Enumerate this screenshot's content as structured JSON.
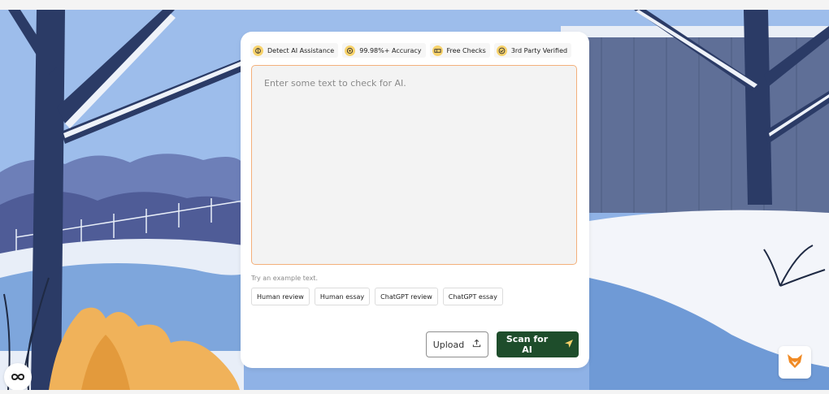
{
  "badges": [
    {
      "label": "Detect AI Assistance",
      "icon": "brain-icon"
    },
    {
      "label": "99.98%+ Accuracy",
      "icon": "target-icon"
    },
    {
      "label": "Free Checks",
      "icon": "ticket-icon"
    },
    {
      "label": "3rd Party Verified",
      "icon": "check-circle-icon"
    }
  ],
  "input": {
    "placeholder": "Enter some text to check for AI.",
    "value": ""
  },
  "examples": {
    "label": "Try an example text.",
    "buttons": [
      "Human review",
      "Human essay",
      "ChatGPT review",
      "ChatGPT essay"
    ]
  },
  "actions": {
    "upload_label": "Upload",
    "scan_label": "Scan for AI"
  },
  "colors": {
    "accent": "#1e4d2b",
    "badge_icon_bg": "#f7d26b",
    "input_border": "#f3b07b",
    "brand_fox": "#f08a24"
  }
}
